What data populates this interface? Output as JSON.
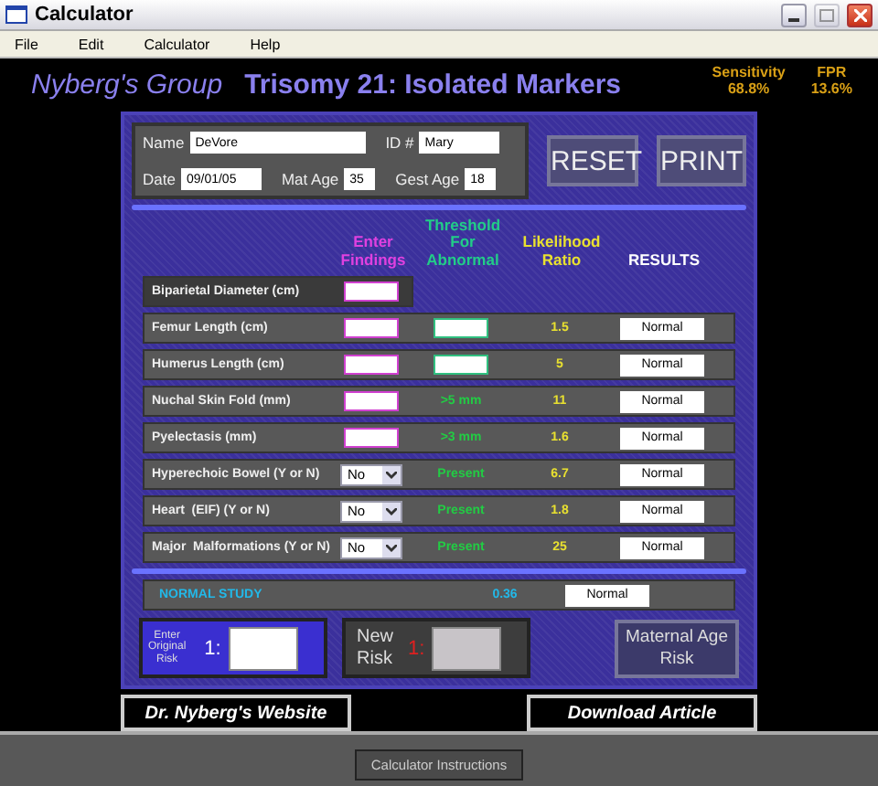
{
  "window": {
    "title": "Calculator",
    "controls": [
      {
        "kind": "minimize",
        "disabled": false
      },
      {
        "kind": "maximize",
        "disabled": true
      },
      {
        "kind": "close",
        "disabled": false
      }
    ]
  },
  "menu": [
    "File",
    "Edit",
    "Calculator",
    "Help"
  ],
  "header": {
    "group": "Nyberg's Group",
    "title": "Trisomy 21: Isolated Markers",
    "stats": [
      {
        "label": "Sensitivity",
        "value": "68.8%"
      },
      {
        "label": "FPR",
        "value": "13.6%"
      }
    ]
  },
  "patient": [
    [
      {
        "label": "Name",
        "value": "DeVore"
      },
      {
        "label": "ID #",
        "value": "Mary"
      }
    ],
    [
      {
        "label": "Date",
        "value": "09/01/05"
      },
      {
        "label": "Mat Age",
        "value": "35"
      },
      {
        "label": "Gest Age",
        "value": "18"
      }
    ]
  ],
  "buttons": [
    "RESET",
    "PRINT"
  ],
  "table": {
    "columns": [
      "Enter Findings",
      "Threshold For Abnormal",
      "Likelihood Ratio",
      "RESULTS"
    ],
    "rows": [
      {
        "label": "Biparietal Diameter (cm)",
        "kind": "number"
      },
      {
        "label": "Femur Length (cm)",
        "kind": "number",
        "threshold_field": true,
        "ratio": "1.5",
        "result": "Normal"
      },
      {
        "label": "Humerus Length (cm)",
        "kind": "number",
        "threshold_field": true,
        "ratio": "5",
        "result": "Normal"
      },
      {
        "label": "Nuchal Skin Fold (mm)",
        "kind": "number",
        "threshold": ">5 mm",
        "ratio": "11",
        "result": "Normal"
      },
      {
        "label": "Pyelectasis (mm)",
        "kind": "number",
        "threshold": ">3 mm",
        "ratio": "1.6",
        "result": "Normal"
      },
      {
        "label": "Hyperechoic Bowel (Y or N)",
        "kind": "choice",
        "value": "No",
        "threshold": "Present",
        "ratio": "6.7",
        "result": "Normal"
      },
      {
        "label": "Heart  (EIF) (Y or N)",
        "kind": "choice",
        "value": "No",
        "threshold": "Present",
        "ratio": "1.8",
        "result": "Normal"
      },
      {
        "label": "Major  Malformations (Y or N)",
        "kind": "choice",
        "value": "No",
        "threshold": "Present",
        "ratio": "25",
        "result": "Normal"
      }
    ]
  },
  "summary": {
    "label": "NORMAL STUDY",
    "ratio": "0.36",
    "result": "Normal"
  },
  "risk": {
    "original_label": "Enter Original Risk",
    "original_prefix": "1:",
    "new_label": "New Risk",
    "new_prefix": "1:",
    "maternal_button": "Maternal Age Risk"
  },
  "links": [
    "Dr. Nyberg's Website",
    "Download Article"
  ],
  "footer_button": "Calculator Instructions"
}
